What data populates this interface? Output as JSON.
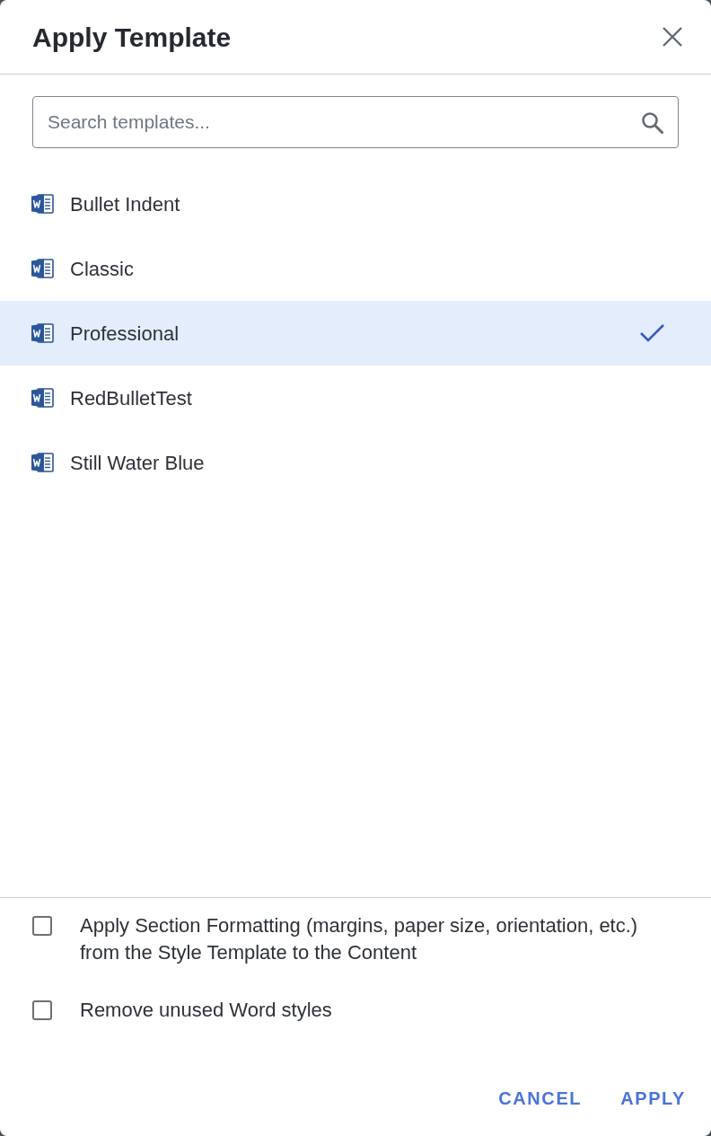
{
  "dialog": {
    "title": "Apply Template"
  },
  "search": {
    "placeholder": "Search templates..."
  },
  "templates": [
    {
      "name": "Bullet Indent",
      "selected": false
    },
    {
      "name": "Classic",
      "selected": false
    },
    {
      "name": "Professional",
      "selected": true
    },
    {
      "name": "RedBulletTest",
      "selected": false
    },
    {
      "name": "Still Water Blue",
      "selected": false
    }
  ],
  "options": [
    {
      "label": "Apply Section Formatting (margins, paper size, orientation, etc.) from the Style Template to the Content",
      "checked": false
    },
    {
      "label": "Remove unused Word styles",
      "checked": false
    }
  ],
  "buttons": [
    {
      "label": "CANCEL"
    },
    {
      "label": "APPLY"
    }
  ]
}
